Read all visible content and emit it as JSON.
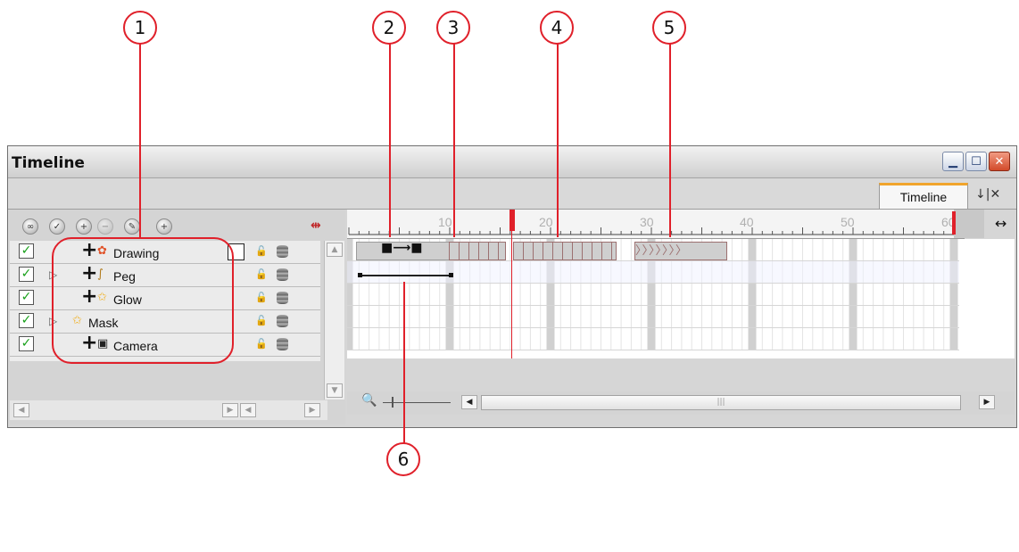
{
  "callouts": [
    "1",
    "2",
    "3",
    "4",
    "5",
    "6"
  ],
  "window": {
    "title": "Timeline"
  },
  "tab": {
    "label": "Timeline"
  },
  "layers": [
    {
      "name": "Drawing",
      "checked": true,
      "icon": "drawing-layer-icon"
    },
    {
      "name": "Peg",
      "checked": true,
      "icon": "peg-layer-icon"
    },
    {
      "name": "Glow",
      "checked": true,
      "icon": "effect-star-icon"
    },
    {
      "name": "Mask",
      "checked": true,
      "icon": "effect-star-icon"
    },
    {
      "name": "Camera",
      "checked": true,
      "icon": "camera-layer-icon"
    }
  ],
  "ruler": {
    "labels": [
      "10",
      "20",
      "30",
      "40",
      "50",
      "60"
    ]
  },
  "colors": {
    "callout": "#e0202a",
    "accent_tab": "#f0a42c",
    "playhead": "#e0202a"
  }
}
